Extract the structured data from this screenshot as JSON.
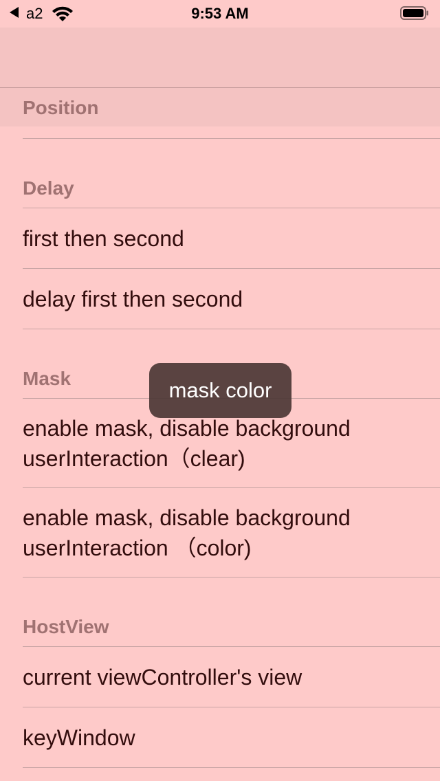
{
  "status_bar": {
    "carrier": "a2",
    "time": "9:53 AM"
  },
  "sections": [
    {
      "header": "Position",
      "items": []
    },
    {
      "header": "Delay",
      "items": [
        "first then second",
        "delay first then second"
      ]
    },
    {
      "header": "Mask",
      "items": [
        "enable mask, disable background userInteraction（clear)",
        "enable mask, disable background userInteraction （color)"
      ]
    },
    {
      "header": "HostView",
      "items": [
        "current viewController's view",
        "keyWindow"
      ]
    }
  ],
  "toast": {
    "text": "mask color"
  },
  "colors": {
    "background": "#fecac9",
    "nav_bar": "#f4c3c2",
    "header_text": "#a07272",
    "cell_text": "#320d0d",
    "toast_bg": "#483432"
  }
}
